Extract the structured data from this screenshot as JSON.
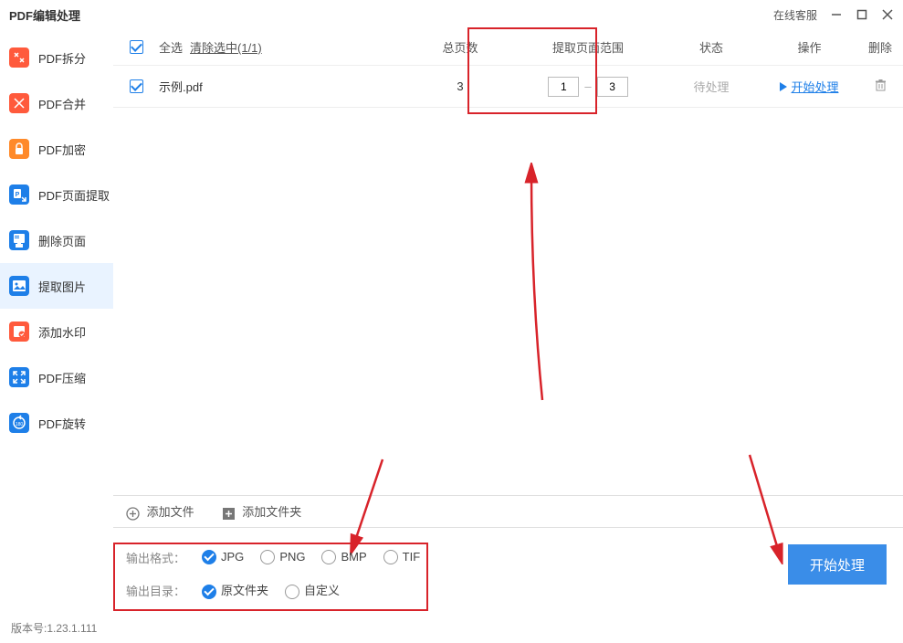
{
  "title": "PDF编辑处理",
  "titlebar": {
    "online_service": "在线客服"
  },
  "sidebar": {
    "items": [
      {
        "label": "PDF拆分"
      },
      {
        "label": "PDF合并"
      },
      {
        "label": "PDF加密"
      },
      {
        "label": "PDF页面提取"
      },
      {
        "label": "删除页面"
      },
      {
        "label": "提取图片"
      },
      {
        "label": "添加水印"
      },
      {
        "label": "PDF压缩"
      },
      {
        "label": "PDF旋转"
      }
    ]
  },
  "table": {
    "select_all": "全选",
    "clear_selected": "清除选中(1/1)",
    "headers": {
      "total_pages": "总页数",
      "range": "提取页面范围",
      "status": "状态",
      "action": "操作",
      "delete": "删除"
    },
    "rows": [
      {
        "name": "示例.pdf",
        "pages": "3",
        "range_from": "1",
        "range_to": "3",
        "status": "待处理",
        "action": "开始处理"
      }
    ]
  },
  "bottom": {
    "add_file": "添加文件",
    "add_folder": "添加文件夹"
  },
  "options": {
    "format_label": "输出格式：",
    "formats": [
      "JPG",
      "PNG",
      "BMP",
      "TIF"
    ],
    "dir_label": "输出目录：",
    "dirs": [
      "原文件夹",
      "自定义"
    ]
  },
  "start_button": "开始处理",
  "version": "版本号:1.23.1.111"
}
